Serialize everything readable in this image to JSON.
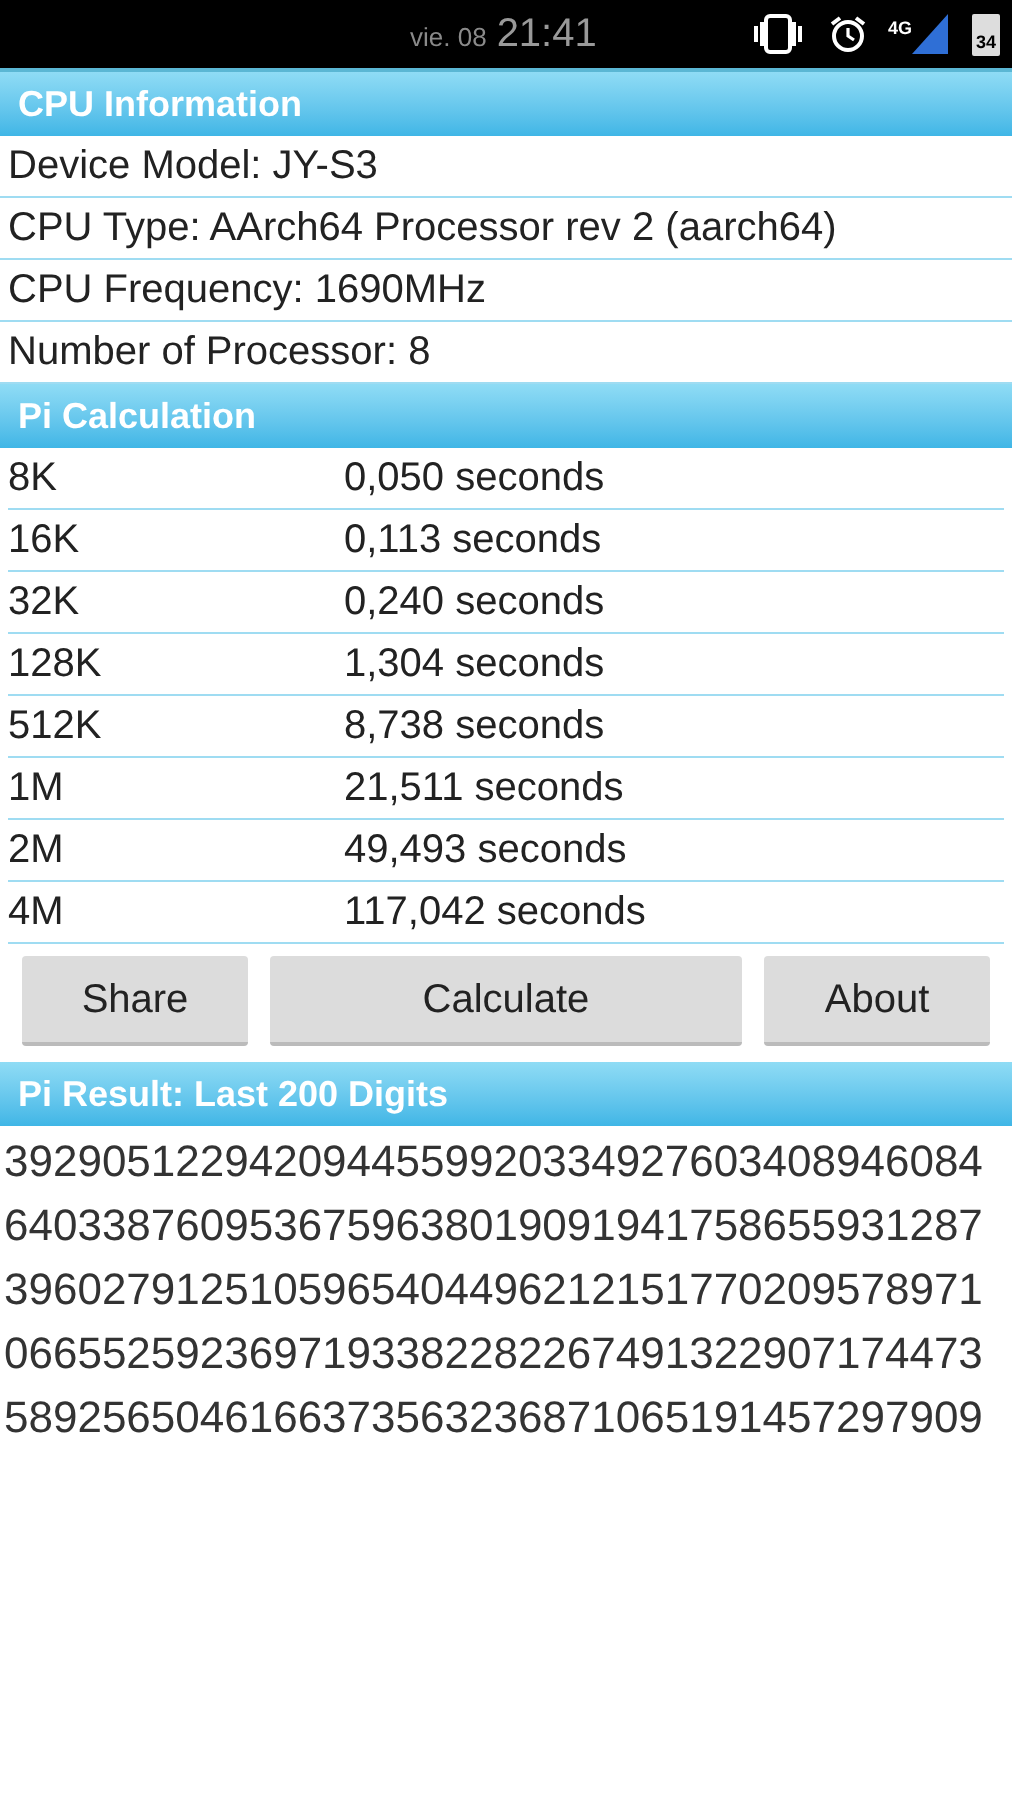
{
  "status_bar": {
    "date": "vie. 08",
    "time": "21:41",
    "network": "4G",
    "battery": "34"
  },
  "cpu_info": {
    "title": "CPU Information",
    "rows": [
      {
        "text": "Device Model: JY-S3"
      },
      {
        "text": "CPU Type: AArch64 Processor rev 2 (aarch64)"
      },
      {
        "text": "CPU Frequency: 1690MHz"
      },
      {
        "text": "Number of Processor: 8"
      }
    ]
  },
  "pi_calculation": {
    "title": "Pi Calculation",
    "rows": [
      {
        "size": "8K",
        "time": "0,050 seconds"
      },
      {
        "size": "16K",
        "time": "0,113 seconds"
      },
      {
        "size": "32K",
        "time": "0,240 seconds"
      },
      {
        "size": "128K",
        "time": "1,304 seconds"
      },
      {
        "size": "512K",
        "time": "8,738 seconds"
      },
      {
        "size": "1M",
        "time": "21,511 seconds"
      },
      {
        "size": "2M",
        "time": "49,493 seconds"
      },
      {
        "size": "4M",
        "time": "117,042 seconds"
      }
    ]
  },
  "buttons": [
    "Share",
    "Calculate",
    "About"
  ],
  "pi_result": {
    "title": "Pi Result: Last 200 Digits",
    "lines": [
      "3929051229420944559920334927603408946084",
      "6403387609536759638019091941758655931287",
      "3960279125105965404496212151770209578971",
      "0665525923697193382282267491322907174473",
      "5892565046166373563236871065191457297909"
    ]
  }
}
